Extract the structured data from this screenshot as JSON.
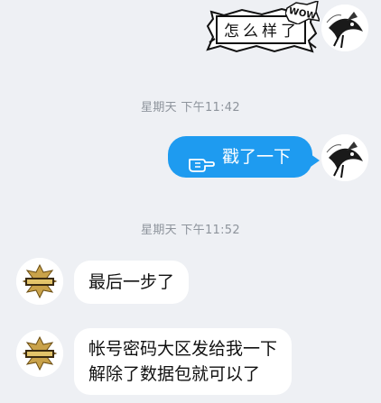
{
  "messages": [
    {
      "side": "right",
      "kind": "sticker",
      "text": "怎么样了",
      "sticker_badge": "WOW"
    },
    {
      "kind": "timestamp",
      "text": "星期天 下午11:42"
    },
    {
      "side": "right",
      "kind": "poke",
      "text": "戳了一下",
      "icon": "poke-hand-icon"
    },
    {
      "kind": "timestamp",
      "text": "星期天 下午11:52"
    },
    {
      "side": "left",
      "kind": "text",
      "text": "最后一步了"
    },
    {
      "side": "left",
      "kind": "text",
      "lines": [
        "帐号密码大区发给我一下",
        "解除了数据包就可以了"
      ]
    }
  ],
  "colors": {
    "background": "#eef0f4",
    "poke_bubble": "#1e9bf0",
    "incoming_bubble": "#ffffff",
    "timestamp_text": "#8e949c"
  },
  "avatars": {
    "self": "bird-sketch-avatar",
    "contact": "game-logo-avatar"
  }
}
